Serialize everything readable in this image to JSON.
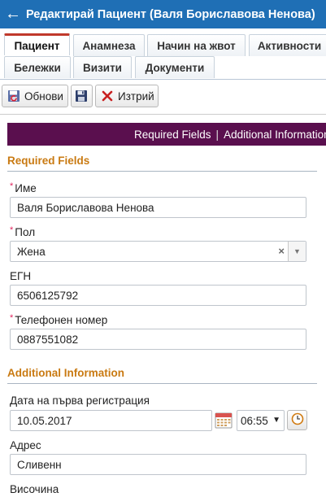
{
  "header": {
    "back_icon": "arrow-left-icon",
    "title": "Редактирай Пациент (Валя Бориславова Ненова)"
  },
  "tabs": [
    {
      "label": "Пациент",
      "active": true
    },
    {
      "label": "Анамнеза",
      "active": false
    },
    {
      "label": "Начин на жвот",
      "active": false
    },
    {
      "label": "Активности",
      "active": false
    },
    {
      "label": "Бележки",
      "active": false
    },
    {
      "label": "Визити",
      "active": false
    },
    {
      "label": "Документи",
      "active": false
    }
  ],
  "toolbar": {
    "refresh_label": "Обнови",
    "save_icon": "floppy-disk-icon",
    "delete_label": "Изтрий"
  },
  "section_nav": {
    "required": "Required Fields",
    "separator": "|",
    "additional": "Additional Information"
  },
  "required_section": {
    "heading": "Required Fields",
    "name_label": "Име",
    "name_value": "Валя Бориславова Ненова",
    "gender_label": "Пол",
    "gender_value": "Жена",
    "egn_label": "ЕГН",
    "egn_value": "6506125792",
    "phone_label": "Телефонен номер",
    "phone_value": "0887551082",
    "required_marker": "*"
  },
  "additional_section": {
    "heading": "Additional Information",
    "reg_date_label": "Дата на първа регистрация",
    "reg_date_value": "10.05.2017",
    "reg_time_value": "06:55",
    "address_label": "Адрес",
    "address_value": "Сливенн",
    "height_label": "Височина"
  },
  "colors": {
    "titlebar": "#1f6fb5",
    "section_bar": "#5a0f4e",
    "heading": "#c97a12",
    "required_star": "#e0245e"
  }
}
